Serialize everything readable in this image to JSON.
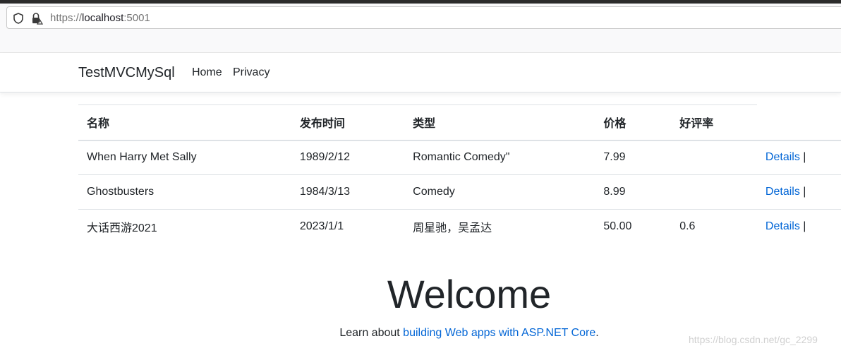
{
  "browser": {
    "url_scheme": "https://",
    "url_host": "localhost",
    "url_port": ":5001",
    "icons": [
      "shield-icon",
      "lock-warning-icon"
    ]
  },
  "navbar": {
    "brand": "TestMVCMySql",
    "links": [
      "Home",
      "Privacy"
    ]
  },
  "table": {
    "headers": [
      "名称",
      "发布时间",
      "类型",
      "价格",
      "好评率"
    ],
    "rows": [
      {
        "name": "When Harry Met Sally",
        "date": "1989/2/12",
        "genre": "Romantic Comedy\"",
        "price": "7.99",
        "rating": "",
        "details": "Details",
        "sep": "|"
      },
      {
        "name": "Ghostbusters",
        "date": "1984/3/13",
        "genre": "Comedy",
        "price": "8.99",
        "rating": "",
        "details": "Details",
        "sep": "|"
      },
      {
        "name": "大话西游2021",
        "date": "2023/1/1",
        "genre": "周星驰，吴孟达",
        "price": "50.00",
        "rating": "0.6",
        "details": "Details",
        "sep": "|"
      }
    ]
  },
  "main": {
    "heading": "Welcome",
    "learn_prefix": "Learn about ",
    "learn_link": "building Web apps with ASP.NET Core",
    "learn_suffix": "."
  },
  "watermark": "https://blog.csdn.net/gc_2299",
  "colors": {
    "link": "#0366d6",
    "text": "#212529",
    "border": "#dee2e6"
  }
}
